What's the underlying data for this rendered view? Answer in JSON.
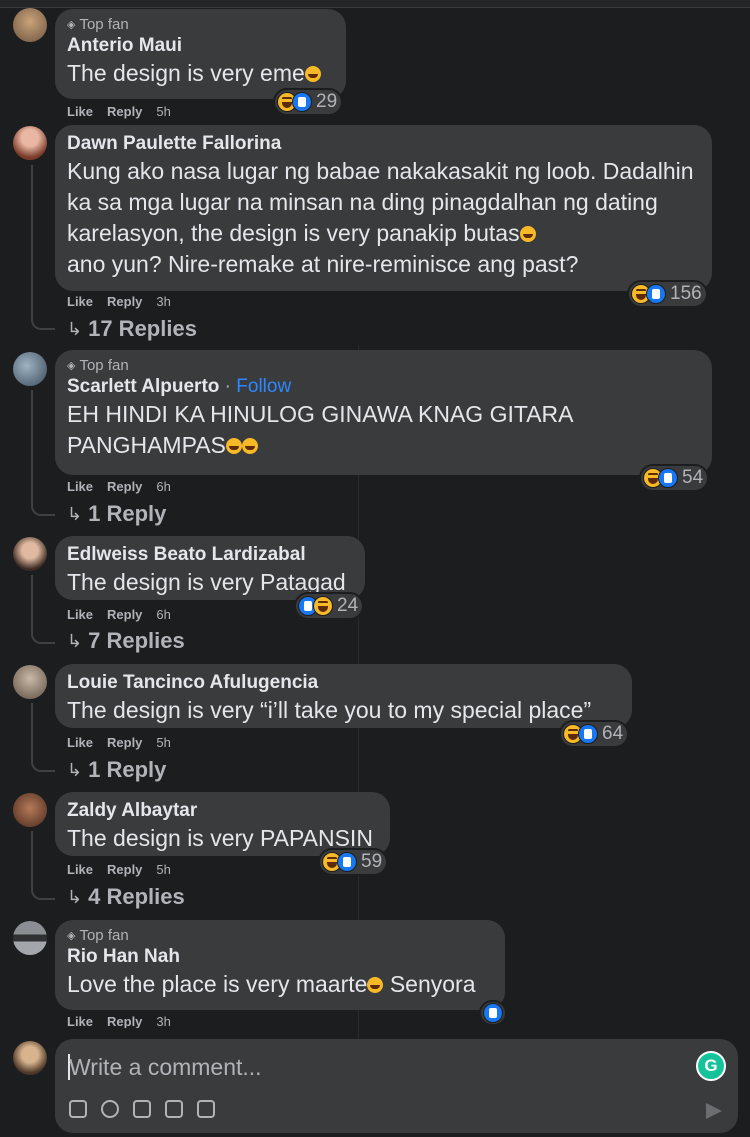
{
  "comments": [
    {
      "top_fan": "Top fan",
      "name": "Anterio Maui",
      "text": "The design is very eme",
      "actions": {
        "like": "Like",
        "reply": "Reply",
        "time": "5h"
      },
      "reaction_count": "29"
    },
    {
      "name": "Dawn Paulette Fallorina",
      "text": "Kung ako nasa lugar ng babae nakakasakit ng loob. Dadalhin ka sa mga lugar na minsan na ding pinagdalhan ng dating karelasyon, the design is very panakip butas",
      "text2": "ano yun? Nire-remake at nire-reminisce ang past?",
      "actions": {
        "like": "Like",
        "reply": "Reply",
        "time": "3h"
      },
      "reaction_count": "156",
      "replies": "17 Replies"
    },
    {
      "top_fan": "Top fan",
      "name": "Scarlett Alpuerto",
      "follow": "Follow",
      "text": "EH HINDI KA HINULOG GINAWA KNAG GITARA PANGHAMPAS",
      "actions": {
        "like": "Like",
        "reply": "Reply",
        "time": "6h"
      },
      "reaction_count": "54",
      "replies": "1 Reply"
    },
    {
      "name": "Edlweiss Beato Lardizabal",
      "text": "The design is very Patagad",
      "actions": {
        "like": "Like",
        "reply": "Reply",
        "time": "6h"
      },
      "reaction_count": "24",
      "replies": "7 Replies"
    },
    {
      "name": "Louie Tancinco Afulugencia",
      "text": "The design is very “i’ll take you to my special place”",
      "actions": {
        "like": "Like",
        "reply": "Reply",
        "time": "5h"
      },
      "reaction_count": "64",
      "replies": "1 Reply"
    },
    {
      "name": "Zaldy Albaytar",
      "text": "The design is very PAPANSIN",
      "actions": {
        "like": "Like",
        "reply": "Reply",
        "time": "5h"
      },
      "reaction_count": "59",
      "replies": "4 Replies"
    },
    {
      "top_fan": "Top fan",
      "name": "Rio Han Nah",
      "text": "Love the place is very maarte",
      "text_after": "Senyora",
      "actions": {
        "like": "Like",
        "reply": "Reply",
        "time": "3h"
      }
    }
  ],
  "composer": {
    "placeholder": "Write a comment...",
    "grammarly": "G"
  },
  "colors": {
    "background": "#1c1d1f",
    "bubble": "#3a3b3c",
    "link": "#2d88ff",
    "like_blue": "#1877f2",
    "haha_yellow": "#f7b928"
  }
}
